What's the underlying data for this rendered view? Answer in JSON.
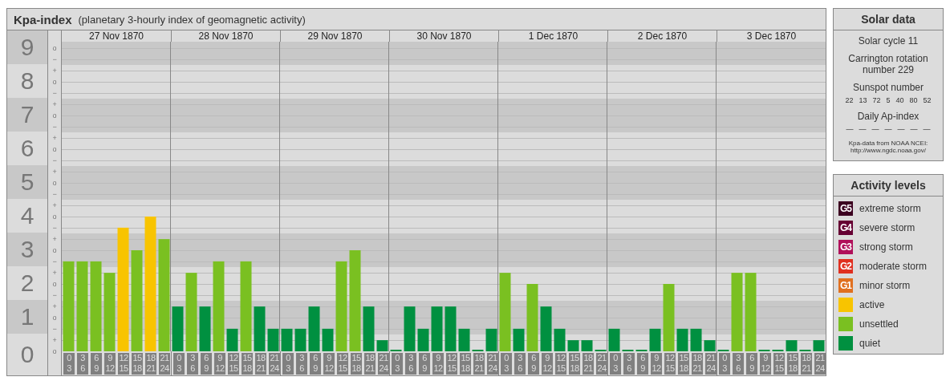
{
  "header": {
    "title": "Kpa-index",
    "subtitle": "(planetary 3-hourly index of geomagnetic activity)"
  },
  "kp_chart": {
    "subtick_labels": [
      "o",
      "−",
      "+",
      "o",
      "−",
      "+",
      "o",
      "−",
      "+",
      "o",
      "−",
      "+",
      "o",
      "−",
      "+",
      "o",
      "−",
      "+",
      "o",
      "−",
      "+",
      "o",
      "−",
      "+",
      "o",
      "−",
      "+",
      "o"
    ],
    "day_labels": [
      "27 Nov 1870",
      "28 Nov 1870",
      "29 Nov 1870",
      "30 Nov 1870",
      "1 Dec 1870",
      "2 Dec 1870",
      "3 Dec 1870"
    ],
    "chart_data": {
      "type": "bar",
      "grid": true,
      "ylim": [
        0,
        9
      ],
      "yticks": [
        0,
        1,
        2,
        3,
        4,
        5,
        6,
        7,
        8,
        9
      ],
      "categories": [
        "0\n3",
        "3\n6",
        "6\n9",
        "9\n12",
        "12\n15",
        "15\n18",
        "18\n21",
        "21\n24",
        "0\n3",
        "3\n6",
        "6\n9",
        "9\n12",
        "12\n15",
        "15\n18",
        "18\n21",
        "21\n24",
        "0\n3",
        "3\n6",
        "6\n9",
        "9\n12",
        "12\n15",
        "15\n18",
        "18\n21",
        "21\n24",
        "0\n3",
        "3\n6",
        "6\n9",
        "9\n12",
        "12\n15",
        "15\n18",
        "18\n21",
        "21\n24",
        "0\n3",
        "3\n6",
        "6\n9",
        "9\n12",
        "12\n15",
        "15\n18",
        "18\n21",
        "21\n24",
        "0\n3",
        "3\n6",
        "6\n9",
        "9\n12",
        "12\n15",
        "15\n18",
        "18\n21",
        "21\n24",
        "0\n3",
        "3\n6",
        "6\n9",
        "9\n12",
        "12\n15",
        "15\n18",
        "18\n21",
        "21\n24"
      ],
      "series": [
        {
          "color": "#009040",
          "values": [
            null,
            null,
            null,
            null,
            null,
            null,
            null,
            null,
            1.33,
            null,
            1.33,
            null,
            0.67,
            null,
            1.33,
            0.67,
            0.67,
            0.67,
            1.33,
            0.67,
            null,
            null,
            1.33,
            0.33,
            0,
            1.33,
            0.67,
            1.33,
            1.33,
            0.67,
            0,
            0.67,
            null,
            0.67,
            null,
            1.33,
            0.67,
            0.33,
            0.33,
            0,
            0.67,
            0,
            0,
            0.67,
            null,
            0.67,
            0.67,
            0.33,
            0,
            null,
            null,
            0,
            0,
            0.33,
            0,
            0.33
          ]
        },
        {
          "color": "#7ac021",
          "values": [
            2.67,
            2.67,
            2.67,
            2.33,
            null,
            3,
            null,
            3.33,
            null,
            2.33,
            null,
            2.67,
            null,
            2.67,
            null,
            null,
            null,
            null,
            null,
            null,
            2.67,
            3,
            null,
            null,
            null,
            null,
            null,
            null,
            null,
            null,
            null,
            null,
            2.33,
            null,
            2,
            null,
            null,
            null,
            null,
            null,
            null,
            null,
            null,
            null,
            2,
            null,
            null,
            null,
            null,
            2.33,
            2.33,
            null,
            null,
            null,
            null,
            null
          ]
        },
        {
          "color": "#f8c400",
          "values": [
            null,
            null,
            null,
            null,
            3.67,
            null,
            4,
            null,
            null,
            null,
            null,
            null,
            null,
            null,
            null,
            null,
            null,
            null,
            null,
            null,
            null,
            null,
            null,
            null,
            null,
            null,
            null,
            null,
            null,
            null,
            null,
            null,
            null,
            null,
            null,
            null,
            null,
            null,
            null,
            null,
            null,
            null,
            null,
            null,
            null,
            null,
            null,
            null,
            null,
            null,
            null,
            null,
            null,
            null,
            null,
            null
          ]
        }
      ]
    }
  },
  "solar_data": {
    "title": "Solar data",
    "solar_cycle": "Solar cycle 11",
    "carrington": "Carrington rotation number 229",
    "sunspot_title": "Sunspot number",
    "sunspots": [
      "22",
      "13",
      "72",
      "5",
      "40",
      "80",
      "52"
    ],
    "ap_title": "Daily Ap-index",
    "ap_values": [
      "—",
      "—",
      "—",
      "—",
      "—",
      "—",
      "—"
    ],
    "source": "Kpa-data from NOAA NCEI:",
    "source_url": "http://www.ngdc.noaa.gov/"
  },
  "activity_levels": {
    "title": "Activity levels",
    "items": [
      {
        "badge": "G5",
        "label": "extreme storm",
        "color": "#3c0020"
      },
      {
        "badge": "G4",
        "label": "severe storm",
        "color": "#660033"
      },
      {
        "badge": "G3",
        "label": "strong storm",
        "color": "#b0105a"
      },
      {
        "badge": "G2",
        "label": "moderate storm",
        "color": "#e03020"
      },
      {
        "badge": "G1",
        "label": "minor storm",
        "color": "#e07020"
      },
      {
        "label": "active",
        "color": "#f8c400"
      },
      {
        "label": "unsettled",
        "color": "#7ac021"
      },
      {
        "label": "quiet",
        "color": "#009040"
      }
    ]
  }
}
